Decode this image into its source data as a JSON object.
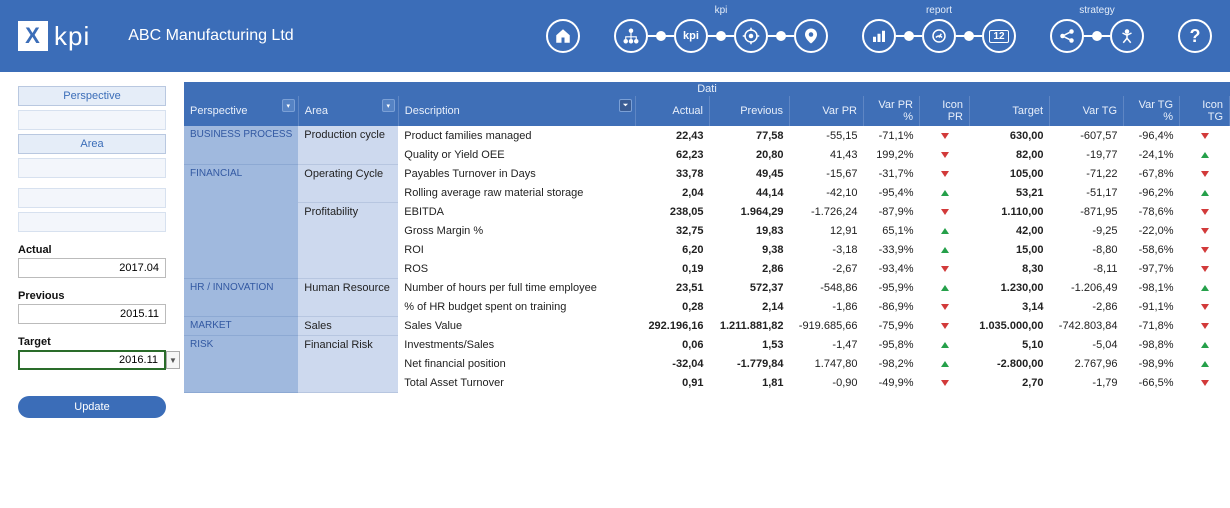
{
  "header": {
    "logo_text": "kpi",
    "company": "ABC Manufacturing Ltd",
    "nav_labels": {
      "kpi": "kpi",
      "report": "report",
      "strategy": "strategy"
    },
    "kpi_text": "kpi",
    "cal_text": "12",
    "help_text": "?"
  },
  "sidebar": {
    "perspective_label": "Perspective",
    "area_label": "Area",
    "actual_label": "Actual",
    "actual_value": "2017.04",
    "previous_label": "Previous",
    "previous_value": "2015.11",
    "target_label": "Target",
    "target_value": "2016.11",
    "update_label": "Update"
  },
  "table": {
    "dati": "Dati",
    "headers": {
      "perspective": "Perspective",
      "area": "Area",
      "description": "Description",
      "actual": "Actual",
      "previous": "Previous",
      "var_pr": "Var PR",
      "var_pr_pct": "Var PR %",
      "icon_pr": "Icon PR",
      "target": "Target",
      "var_tg": "Var TG",
      "var_tg_pct": "Var TG %",
      "icon_tg": "Icon TG"
    },
    "rows": [
      {
        "perspective": "BUSINESS PROCESS",
        "p_rows": 2,
        "area": "Production cycle",
        "a_rows": 2,
        "desc": "Product families managed",
        "actual": "22,43",
        "previous": "77,58",
        "var_pr": "-55,15",
        "var_pr_pct": "-71,1%",
        "icon_pr": "down",
        "target": "630,00",
        "var_tg": "-607,57",
        "var_tg_pct": "-96,4%",
        "icon_tg": "down"
      },
      {
        "desc": "Quality or Yield OEE",
        "actual": "62,23",
        "previous": "20,80",
        "var_pr": "41,43",
        "var_pr_pct": "199,2%",
        "icon_pr": "down",
        "target": "82,00",
        "var_tg": "-19,77",
        "var_tg_pct": "-24,1%",
        "icon_tg": "up"
      },
      {
        "perspective": "FINANCIAL",
        "p_rows": 6,
        "area": "Operating Cycle",
        "a_rows": 2,
        "desc": "Payables Turnover in Days",
        "actual": "33,78",
        "previous": "49,45",
        "var_pr": "-15,67",
        "var_pr_pct": "-31,7%",
        "icon_pr": "down",
        "target": "105,00",
        "var_tg": "-71,22",
        "var_tg_pct": "-67,8%",
        "icon_tg": "down"
      },
      {
        "desc": "Rolling average raw material storage",
        "actual": "2,04",
        "previous": "44,14",
        "var_pr": "-42,10",
        "var_pr_pct": "-95,4%",
        "icon_pr": "up",
        "target": "53,21",
        "var_tg": "-51,17",
        "var_tg_pct": "-96,2%",
        "icon_tg": "up"
      },
      {
        "area": "Profitability",
        "a_rows": 4,
        "desc": "EBITDA",
        "actual": "238,05",
        "previous": "1.964,29",
        "var_pr": "-1.726,24",
        "var_pr_pct": "-87,9%",
        "icon_pr": "down",
        "target": "1.110,00",
        "var_tg": "-871,95",
        "var_tg_pct": "-78,6%",
        "icon_tg": "down"
      },
      {
        "desc": "Gross Margin %",
        "actual": "32,75",
        "previous": "19,83",
        "var_pr": "12,91",
        "var_pr_pct": "65,1%",
        "icon_pr": "up",
        "target": "42,00",
        "var_tg": "-9,25",
        "var_tg_pct": "-22,0%",
        "icon_tg": "down"
      },
      {
        "desc": "ROI",
        "actual": "6,20",
        "previous": "9,38",
        "var_pr": "-3,18",
        "var_pr_pct": "-33,9%",
        "icon_pr": "up",
        "target": "15,00",
        "var_tg": "-8,80",
        "var_tg_pct": "-58,6%",
        "icon_tg": "down"
      },
      {
        "desc": "ROS",
        "actual": "0,19",
        "previous": "2,86",
        "var_pr": "-2,67",
        "var_pr_pct": "-93,4%",
        "icon_pr": "down",
        "target": "8,30",
        "var_tg": "-8,11",
        "var_tg_pct": "-97,7%",
        "icon_tg": "down"
      },
      {
        "perspective": "HR / INNOVATION",
        "p_rows": 2,
        "area": "Human Resource",
        "a_rows": 2,
        "desc": "Number of hours per full time employee",
        "actual": "23,51",
        "previous": "572,37",
        "var_pr": "-548,86",
        "var_pr_pct": "-95,9%",
        "icon_pr": "up",
        "target": "1.230,00",
        "var_tg": "-1.206,49",
        "var_tg_pct": "-98,1%",
        "icon_tg": "up"
      },
      {
        "desc": "% of HR budget spent on training",
        "actual": "0,28",
        "previous": "2,14",
        "var_pr": "-1,86",
        "var_pr_pct": "-86,9%",
        "icon_pr": "down",
        "target": "3,14",
        "var_tg": "-2,86",
        "var_tg_pct": "-91,1%",
        "icon_tg": "down"
      },
      {
        "perspective": "MARKET",
        "p_rows": 1,
        "area": "Sales",
        "a_rows": 1,
        "desc": "Sales Value",
        "actual": "292.196,16",
        "previous": "1.211.881,82",
        "var_pr": "-919.685,66",
        "var_pr_pct": "-75,9%",
        "icon_pr": "down",
        "target": "1.035.000,00",
        "var_tg": "-742.803,84",
        "var_tg_pct": "-71,8%",
        "icon_tg": "down"
      },
      {
        "perspective": "RISK",
        "p_rows": 3,
        "area": "Financial Risk",
        "a_rows": 3,
        "desc": "Investments/Sales",
        "actual": "0,06",
        "previous": "1,53",
        "var_pr": "-1,47",
        "var_pr_pct": "-95,8%",
        "icon_pr": "up",
        "target": "5,10",
        "var_tg": "-5,04",
        "var_tg_pct": "-98,8%",
        "icon_tg": "up"
      },
      {
        "desc": "Net financial position",
        "actual": "-32,04",
        "previous": "-1.779,84",
        "var_pr": "1.747,80",
        "var_pr_pct": "-98,2%",
        "icon_pr": "up",
        "target": "-2.800,00",
        "var_tg": "2.767,96",
        "var_tg_pct": "-98,9%",
        "icon_tg": "up"
      },
      {
        "desc": "Total Asset Turnover",
        "actual": "0,91",
        "previous": "1,81",
        "var_pr": "-0,90",
        "var_pr_pct": "-49,9%",
        "icon_pr": "down",
        "target": "2,70",
        "var_tg": "-1,79",
        "var_tg_pct": "-66,5%",
        "icon_tg": "down"
      }
    ]
  }
}
